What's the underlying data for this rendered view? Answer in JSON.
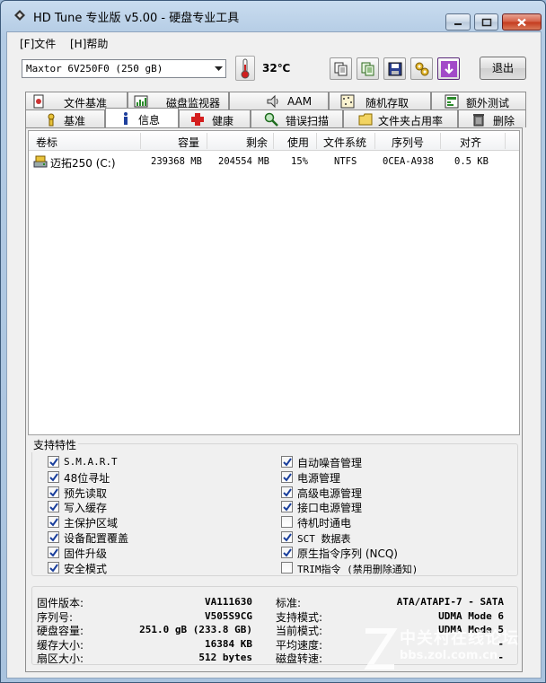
{
  "window": {
    "title": "HD Tune 专业版 v5.00 - 硬盘专业工具"
  },
  "menu": [
    {
      "label": "[F]文件"
    },
    {
      "label": "[H]帮助"
    }
  ],
  "toolbar": {
    "drive": "Maxtor 6V250F0 (250 gB)",
    "temperature": "32℃",
    "exit_label": "退出"
  },
  "tabs_row1": [
    {
      "label": "文件基准",
      "icon": "file-benchmark-icon"
    },
    {
      "label": "磁盘监视器",
      "icon": "disk-monitor-icon"
    },
    {
      "label": "AAM",
      "icon": "speaker-icon"
    },
    {
      "label": "随机存取",
      "icon": "random-access-icon"
    },
    {
      "label": "额外测试",
      "icon": "extra-tests-icon"
    }
  ],
  "tabs_row2": [
    {
      "label": "基准",
      "icon": "benchmark-icon"
    },
    {
      "label": "信息",
      "icon": "info-icon",
      "active": true
    },
    {
      "label": "健康",
      "icon": "health-icon"
    },
    {
      "label": "错误扫描",
      "icon": "error-scan-icon"
    },
    {
      "label": "文件夹占用率",
      "icon": "folder-usage-icon"
    },
    {
      "label": "删除",
      "icon": "erase-icon"
    }
  ],
  "volumes": {
    "columns": [
      "卷标",
      "容量",
      "剩余",
      "使用",
      "文件系统",
      "序列号",
      "对齐"
    ],
    "rows": [
      {
        "label": "迈拓250 (C:)",
        "capacity": "239368 MB",
        "free": "204554 MB",
        "used": "15%",
        "fs": "NTFS",
        "serial": "0CEA-A938",
        "align": "0.5 KB"
      }
    ]
  },
  "features": {
    "title": "支持特性",
    "left": [
      {
        "label": "S.M.A.R.T",
        "checked": true
      },
      {
        "label": "48位寻址",
        "checked": true
      },
      {
        "label": "预先读取",
        "checked": true
      },
      {
        "label": "写入缓存",
        "checked": true
      },
      {
        "label": "主保护区域",
        "checked": true
      },
      {
        "label": "设备配置覆盖",
        "checked": true
      },
      {
        "label": "固件升级",
        "checked": true
      },
      {
        "label": "安全模式",
        "checked": true
      }
    ],
    "right": [
      {
        "label": "自动噪音管理",
        "checked": true
      },
      {
        "label": "电源管理",
        "checked": true
      },
      {
        "label": "高级电源管理",
        "checked": true
      },
      {
        "label": "接口电源管理",
        "checked": true
      },
      {
        "label": "待机时通电",
        "checked": false
      },
      {
        "label": "SCT 数据表",
        "checked": true
      },
      {
        "label": "原生指令序列 (NCQ)",
        "checked": true
      },
      {
        "label": "TRIM指令 (禁用删除通知)",
        "checked": false
      }
    ]
  },
  "drive_info": {
    "left": [
      {
        "key": "固件版本:",
        "value": "VA111630"
      },
      {
        "key": "序列号:",
        "value": "V505S9CG"
      },
      {
        "key": "硬盘容量:",
        "value": "251.0 gB (233.8 GB)"
      },
      {
        "key": "缓存大小:",
        "value": "16384 KB"
      },
      {
        "key": "扇区大小:",
        "value": "512 bytes"
      }
    ],
    "right": [
      {
        "key": "标准:",
        "value": "ATA/ATAPI-7 - SATA"
      },
      {
        "key": "支持模式:",
        "value": "UDMA Mode 6"
      },
      {
        "key": "当前模式:",
        "value": "UDMA Mode 5"
      },
      {
        "key": "平均速度:",
        "value": "-"
      },
      {
        "key": "磁盘转速:",
        "value": "-"
      }
    ]
  },
  "watermark": {
    "line1": "中关村在线论坛",
    "line2": "bbs.zol.com.cn"
  },
  "colors": {
    "check": "#1a3f9c",
    "title_bar": "#c9dcef"
  }
}
